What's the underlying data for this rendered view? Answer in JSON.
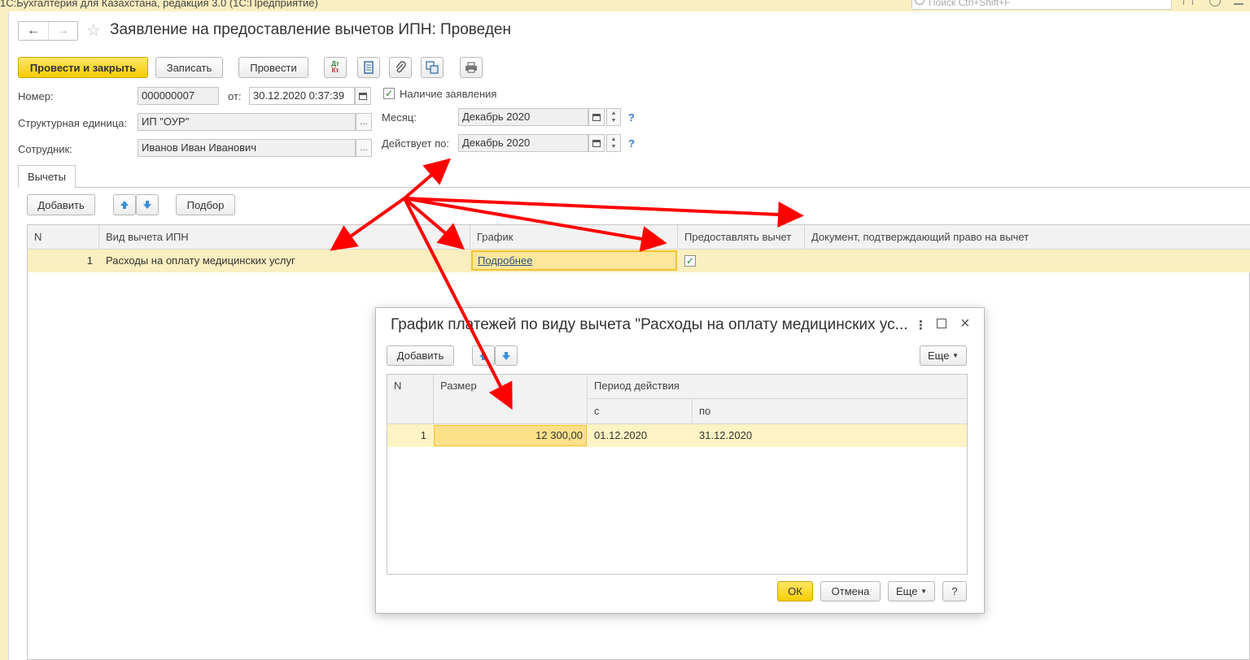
{
  "app": {
    "title": "1С:Бухгалтерия для Казахстана, редакция 3.0 (1С:Предприятие)",
    "search_placeholder": "Поиск Ctrl+Shift+F"
  },
  "document": {
    "title": "Заявление на предоставление вычетов ИПН: Проведен",
    "nav_back": "←",
    "nav_forward": "→",
    "favorite": "☆"
  },
  "toolbar": {
    "post_close": "Провести и закрыть",
    "save": "Записать",
    "post": "Провести",
    "dt": "Дт",
    "kt": "Кт"
  },
  "form": {
    "number_label": "Номер:",
    "number_value": "000000007",
    "date_label": "от:",
    "date_value": "30.12.2020  0:37:39",
    "has_application_label": "Наличие заявления",
    "has_application_checked": true,
    "unit_label": "Структурная единица:",
    "unit_value": "ИП \"ОУР\"",
    "employee_label": "Сотрудник:",
    "employee_value": "Иванов Иван Иванович",
    "month_label": "Месяц:",
    "month_value": "Декабрь 2020",
    "valid_label": "Действует по:",
    "valid_value": "Декабрь 2020",
    "help": "?"
  },
  "tabs": [
    "Вычеты"
  ],
  "table_toolbar": {
    "add": "Добавить",
    "pick": "Подбор"
  },
  "table": {
    "columns": [
      "N",
      "Вид вычета ИПН",
      "График",
      "Предоставлять вычет",
      "Документ, подтверждающий право на вычет"
    ],
    "rows": [
      {
        "n": "1",
        "type": "Расходы на оплату медицинских услуг",
        "schedule": "Подробнее",
        "provide": true,
        "doc": ""
      }
    ]
  },
  "dialog": {
    "title": "График платежей по виду вычета \"Расходы на оплату медицинских ус...",
    "add": "Добавить",
    "more": "Еще",
    "columns": {
      "n": "N",
      "size": "Размер",
      "period": "Период действия",
      "from": "с",
      "to": "по"
    },
    "rows": [
      {
        "n": "1",
        "size": "12 300,00",
        "from": "01.12.2020",
        "to": "31.12.2020"
      }
    ],
    "ok": "ОК",
    "cancel": "Отмена",
    "more2": "Еще",
    "help": "?"
  },
  "colors": {
    "accent_yellow": "#f5cc00",
    "row_highlight": "#fbeec0",
    "arrow_red": "#ff0000"
  }
}
